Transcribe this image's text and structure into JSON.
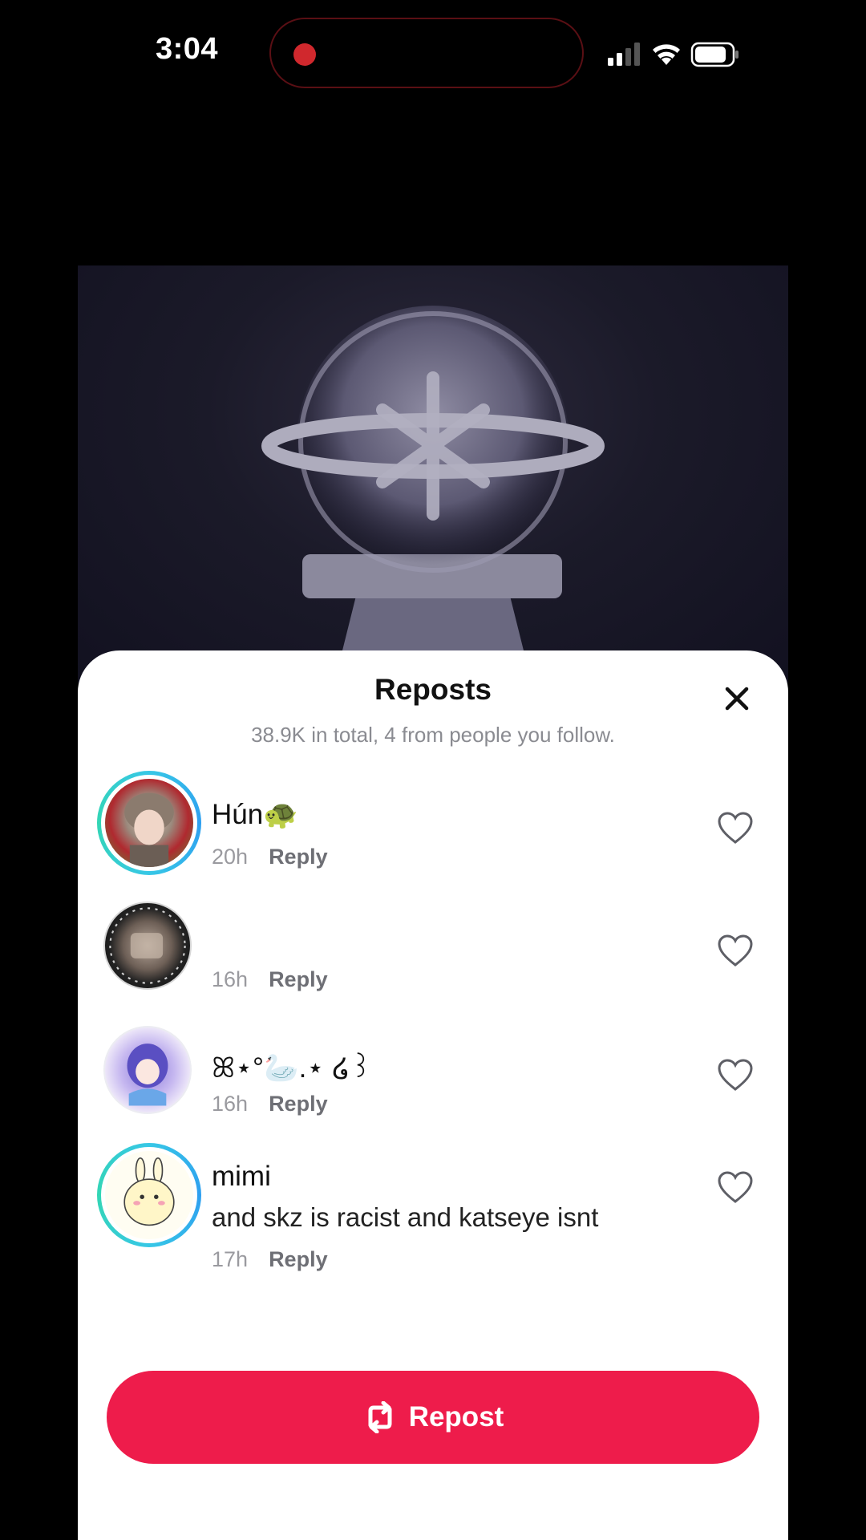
{
  "status_bar": {
    "time": "3:04",
    "recording_indicator_color": "#d0282d",
    "icons": [
      "signal-icon",
      "wifi-icon",
      "battery-icon"
    ]
  },
  "sheet": {
    "title": "Reposts",
    "subtitle": "38.9K in total, 4 from people you follow.",
    "close_icon": "close-icon"
  },
  "reposts": [
    {
      "name": "Hún🐢",
      "comment": "",
      "time": "20h",
      "reply_label": "Reply",
      "liked": false
    },
    {
      "name": "",
      "comment": "",
      "time": "16h",
      "reply_label": "Reply",
      "liked": false
    },
    {
      "name": "ꕤ⋆°🦢.⋆ ໒꒱",
      "comment": "",
      "time": "16h",
      "reply_label": "Reply",
      "liked": false
    },
    {
      "name": "mimi",
      "comment": "and skz is racist and katseye isnt",
      "time": "17h",
      "reply_label": "Reply",
      "liked": false
    }
  ],
  "repost_button": {
    "label": "Repost",
    "color": "#ee1c4b"
  }
}
